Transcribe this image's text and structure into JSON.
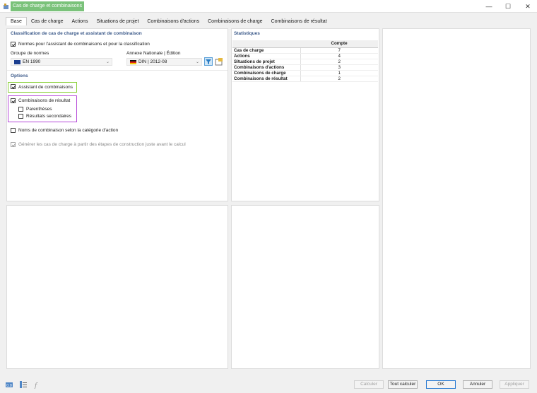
{
  "window": {
    "title": "Cas de charge et combinaisons"
  },
  "tabs": [
    {
      "label": "Base"
    },
    {
      "label": "Cas de charge"
    },
    {
      "label": "Actions"
    },
    {
      "label": "Situations de projet"
    },
    {
      "label": "Combinaisons d'actions"
    },
    {
      "label": "Combinaisons de charge"
    },
    {
      "label": "Combinaisons de résultat"
    }
  ],
  "classification": {
    "title": "Classification de cas de charge et assistant de combinaison",
    "normes_checkbox": "Normes pour l'assistant de combinaisons et pour la classification",
    "groupe_label": "Groupe de normes",
    "groupe_value": "EN 1990",
    "annexe_label": "Annexe Nationale | Édition",
    "annexe_value": "DIN | 2012-08"
  },
  "options": {
    "title": "Options",
    "assistant": "Assistant de combinaisons",
    "combinaisons_resultat": "Combinaisons de résultat",
    "parentheses": "Parenthèses",
    "resultats_secondaires": "Résultats secondaires",
    "noms_combinaison": "Noms de combinaison selon la catégorie d'action",
    "generer": "Générer les cas de charge à partir des étapes de construction juste avant le calcul"
  },
  "statistics": {
    "title": "Statistiques",
    "column_header": "Compte",
    "rows": [
      {
        "name": "Cas de charge",
        "value": "7"
      },
      {
        "name": "Actions",
        "value": "4"
      },
      {
        "name": "Situations de projet",
        "value": "2"
      },
      {
        "name": "Combinaisons d'actions",
        "value": "3"
      },
      {
        "name": "Combinaisons de charge",
        "value": "1"
      },
      {
        "name": "Combinaisons de résultat",
        "value": "2"
      }
    ]
  },
  "buttons": {
    "calculer": "Calculer",
    "tout_calculer": "Tout calculer",
    "ok": "OK",
    "annuler": "Annuler",
    "appliquer": "Appliquer"
  },
  "colors": {
    "accent_green": "#8ad13a",
    "accent_purple": "#b64ad8",
    "title_bg": "#7ac27a",
    "section_title": "#3c5a8a"
  }
}
